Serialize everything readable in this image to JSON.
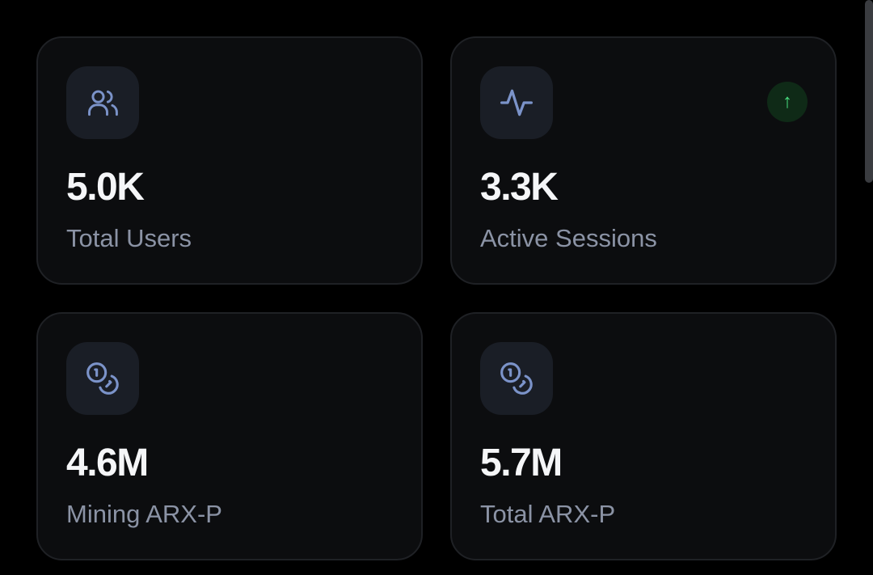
{
  "colors": {
    "accent_icon": "#7b93c9",
    "trend_up": "#4ade80",
    "value_text": "#f5f6f8",
    "label_text": "#8b93a5"
  },
  "stats": [
    {
      "icon": "users-icon",
      "value": "5.0K",
      "label": "Total Users"
    },
    {
      "icon": "activity-icon",
      "value": "3.3K",
      "label": "Active Sessions",
      "trend_icon": "↑"
    },
    {
      "icon": "coins-icon",
      "value": "4.6M",
      "label": "Mining ARX-P"
    },
    {
      "icon": "coins-icon",
      "value": "5.7M",
      "label": "Total ARX-P"
    }
  ]
}
